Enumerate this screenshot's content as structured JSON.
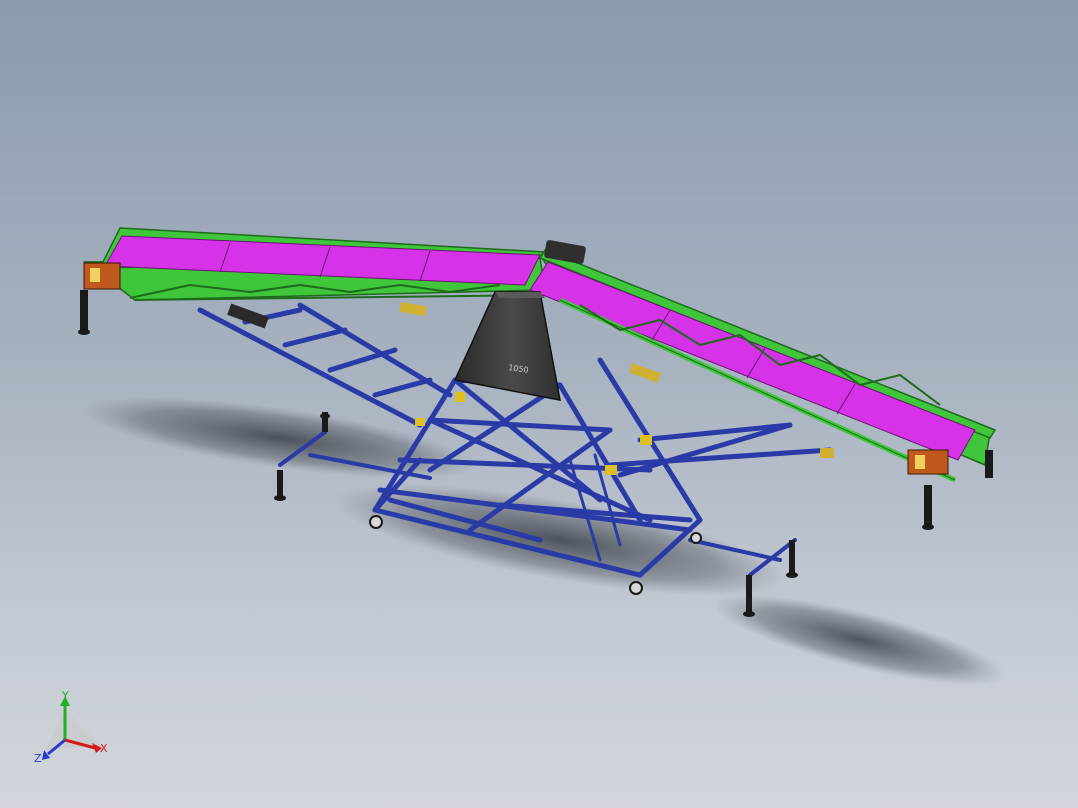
{
  "viewport": {
    "background_top": "#8a9bb0",
    "background_bottom": "#d2d6dc"
  },
  "model": {
    "belt_color": "#d632e8",
    "frame_color": "#3fc63a",
    "stand_color": "#2a3aa6",
    "hopper_color": "#3b3b3b",
    "hopper_label": "1050"
  },
  "triad": {
    "x_label": "X",
    "y_label": "Y",
    "z_label": "Z",
    "x_color": "#d41a1a",
    "y_color": "#22b022",
    "z_color": "#2a3ad0"
  }
}
